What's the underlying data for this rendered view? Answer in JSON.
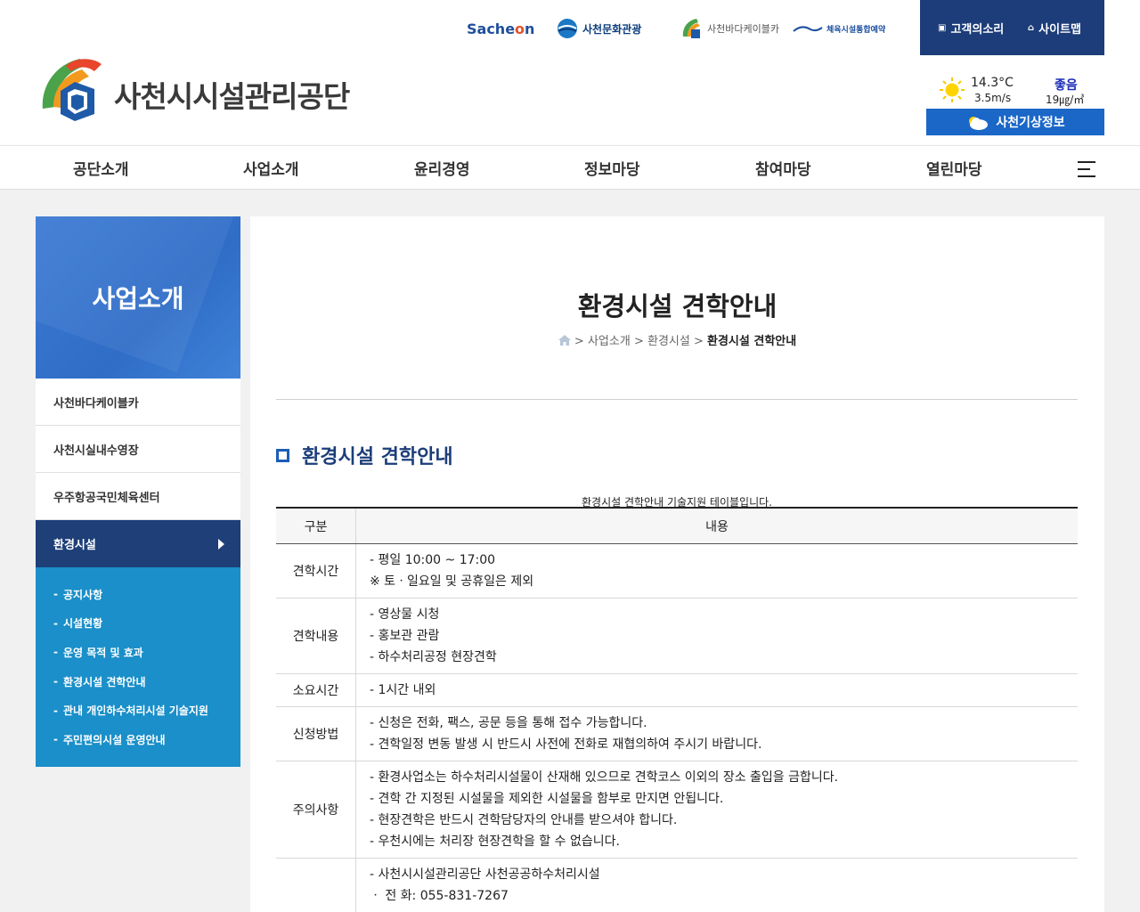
{
  "header": {
    "logo_text": "사천시시설관리공단",
    "family_links": {
      "sachen_prefix": "Sache",
      "sachen_o": "o",
      "sachen_suffix": "n",
      "culture": "사천문화관광",
      "cablecar": "사천바다케이블카",
      "sports": "체육시설통합예약"
    },
    "utility": {
      "voice": "고객의소리",
      "sitemap": "사이트맵"
    },
    "weather": {
      "temperature": "14.3°C",
      "wind": "3.5m/s",
      "air_status": "좋음",
      "air_value": "19㎍/㎥",
      "button": "사천기상정보"
    }
  },
  "gnb": [
    "공단소개",
    "사업소개",
    "윤리경영",
    "정보마당",
    "참여마당",
    "열린마당"
  ],
  "lnb": {
    "title": "사업소개",
    "items": [
      "사천바다케이블카",
      "사천시실내수영장",
      "우주항공국민체육센터"
    ],
    "active": "환경시설",
    "sub_items": [
      "공지사항",
      "시설현황",
      "운영 목적 및 효과",
      "환경시설 견학안내",
      "관내 개인하수처리시설 기술지원",
      "주민편의시설 운영안내"
    ]
  },
  "content": {
    "page_title": "환경시설 견학안내",
    "breadcrumb": {
      "sep": ">",
      "b1": "사업소개",
      "b2": "환경시설",
      "current": "환경시설 견학안내"
    },
    "section_title": "환경시설 견학안내",
    "caption": "환경시설 견학안내 기술지원 테이블입니다.",
    "table": {
      "headers": [
        "구분",
        "내용"
      ],
      "rows": [
        {
          "key": "견학시간",
          "lines": [
            "- 평일 10:00 ~ 17:00",
            "※ 토ㆍ일요일 및 공휴일은 제외"
          ]
        },
        {
          "key": "견학내용",
          "lines": [
            "- 영상물 시청",
            "- 홍보관 관람",
            "- 하수처리공정 현장견학"
          ]
        },
        {
          "key": "소요시간",
          "lines": [
            "- 1시간 내외"
          ]
        },
        {
          "key": "신청방법",
          "lines": [
            "- 신청은 전화, 팩스, 공문 등을 통해 접수 가능합니다.",
            "- 견학일정 변동 발생 시 반드시 사전에 전화로 재협의하여 주시기 바랍니다."
          ]
        },
        {
          "key": "주의사항",
          "lines": [
            "- 환경사업소는 하수처리시설물이 산재해 있으므로 견학코스 이외의 장소 출입을 금합니다.",
            "- 견학 간 지정된 시설물을 제외한 시설물을 함부로 만지면 안됩니다.",
            "- 현장견학은 반드시 견학담당자의 안내를 받으셔야 합니다.",
            "- 우천시에는 처리장 현장견학을 할 수 없습니다."
          ]
        },
        {
          "key": "",
          "lines": [
            "- 사천시시설관리공단 사천공공하수처리시설",
            "ㆍ 전 화: 055-831-7267"
          ]
        }
      ]
    }
  },
  "colors": {
    "navy": "#1c3d79",
    "lnb_sub": "#1a8fc9",
    "weather_button": "#1a67c8"
  }
}
